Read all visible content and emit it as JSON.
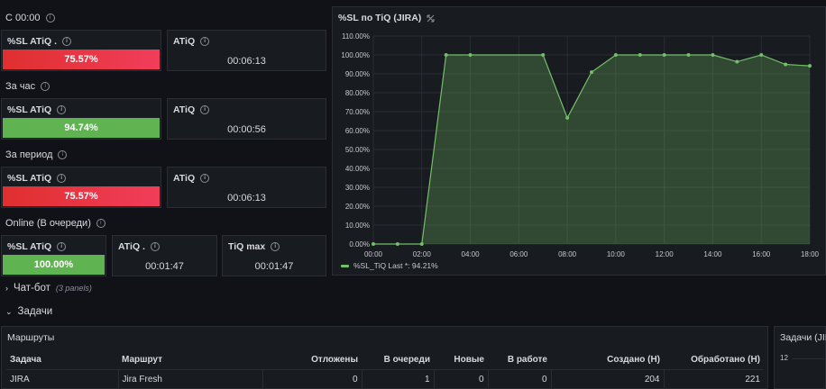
{
  "sections": [
    {
      "title": "С 00:00",
      "stat_label": "%SL ATiQ .",
      "stat_value": "75.57%",
      "stat_color": "red",
      "t_label": "ATiQ",
      "t_value": "00:06:13"
    },
    {
      "title": "За час",
      "stat_label": "%SL ATiQ",
      "stat_value": "94.74%",
      "stat_color": "green",
      "t_label": "ATiQ",
      "t_value": "00:00:56"
    },
    {
      "title": "За период",
      "stat_label": "%SL ATiQ",
      "stat_value": "75.57%",
      "stat_color": "red",
      "t_label": "ATiQ",
      "t_value": "00:06:13"
    }
  ],
  "online": {
    "title": "Online (В очереди)",
    "stat_label": "%SL ATiQ",
    "stat_value": "100.00%",
    "t_label": "ATiQ .",
    "t_value": "00:01:47",
    "max_label": "TiQ max",
    "max_value": "00:01:47"
  },
  "chart_panel_title": "%SL по TiQ (JIRA)",
  "chart_data": {
    "type": "area",
    "title": "%SL по TiQ (JIRA)",
    "x": [
      "00:00",
      "01:00",
      "02:00",
      "03:00",
      "04:00",
      "07:00",
      "08:00",
      "09:00",
      "10:00",
      "11:00",
      "12:00",
      "13:00",
      "14:00",
      "15:00",
      "16:00",
      "17:00",
      "18:00"
    ],
    "series": [
      {
        "name": "%SL_TiQ",
        "values": [
          0,
          0,
          0,
          100,
          100,
          100,
          66.7,
          90.9,
          100,
          100,
          100,
          100,
          100,
          96.4,
          100,
          95,
          94.21
        ]
      }
    ],
    "x_ticks": [
      "00:00",
      "02:00",
      "04:00",
      "06:00",
      "08:00",
      "10:00",
      "12:00",
      "14:00",
      "16:00",
      "18:00"
    ],
    "y_ticks": [
      "0.00%",
      "10.00%",
      "20.00%",
      "30.00%",
      "40.00%",
      "50.00%",
      "60.00%",
      "70.00%",
      "80.00%",
      "90.00%",
      "100.00%",
      "110.00%"
    ],
    "ylim": [
      0,
      110
    ],
    "legend_placement": "bottom-left",
    "legend_text": "%SL_TiQ  Last *: 94.21%",
    "color": "#73bf69",
    "grid": true
  },
  "rows": {
    "chat_label": "Чат-бот",
    "chat_sub": "(3 panels)",
    "tasks_label": "Задачи"
  },
  "routes": {
    "title": "Маршруты",
    "headers": [
      "Задача",
      "Маршрут",
      "Отложены",
      "В очереди",
      "Новые",
      "В работе",
      "Создано (Н)",
      "Обработано (Н)"
    ],
    "rows": [
      [
        "JIRA",
        "Jira Fresh",
        "0",
        "1",
        "0",
        "0",
        "204",
        "221"
      ]
    ]
  },
  "right_panel": {
    "title": "Задачи (JIRA",
    "y_tick": "12"
  }
}
